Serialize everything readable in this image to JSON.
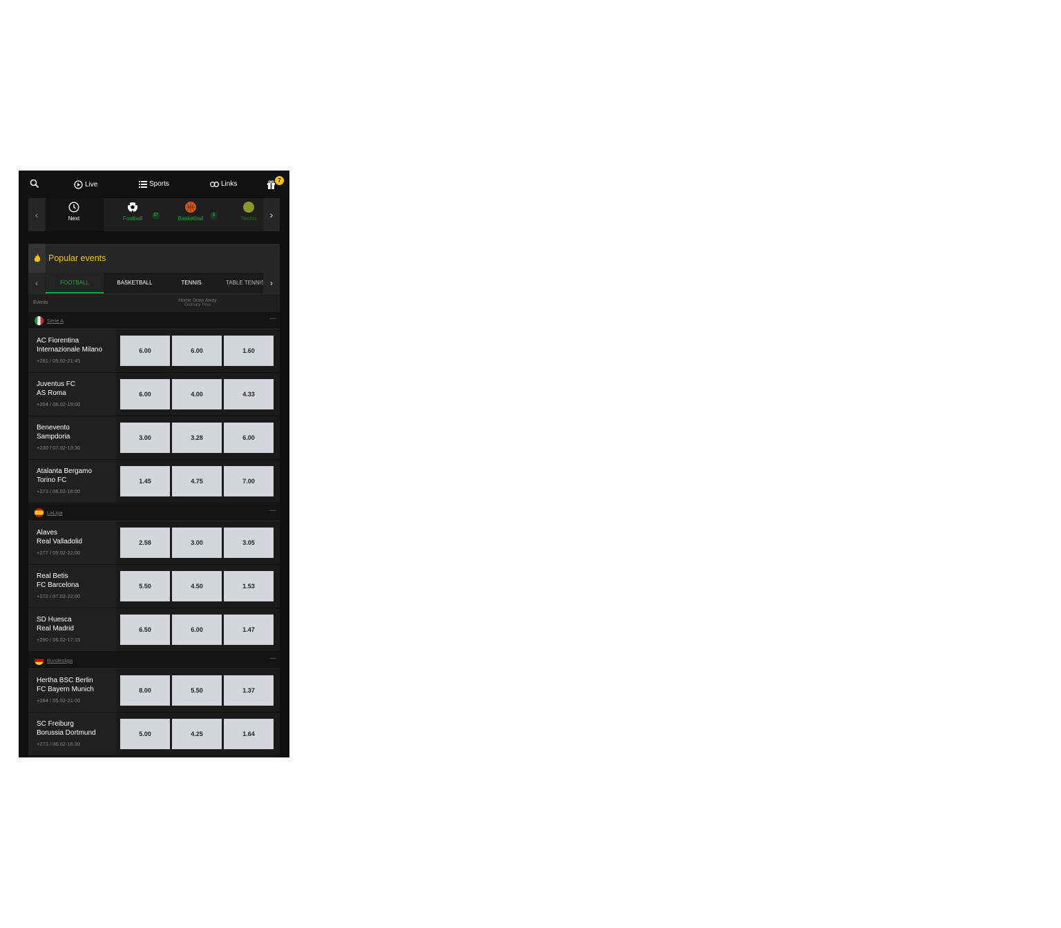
{
  "topnav": {
    "live": "Live",
    "sports": "Sports",
    "links": "Links",
    "gift_badge": "7"
  },
  "sports_bar": {
    "items": [
      {
        "label": "Next",
        "icon": "clock-icon"
      },
      {
        "label": "Football",
        "icon": "football-icon",
        "count": "37"
      },
      {
        "label": "Basketball",
        "icon": "basketball-icon",
        "count": "5"
      },
      {
        "label": "Tennis",
        "icon": "tennis-icon"
      }
    ]
  },
  "popular": {
    "title": "Popular events",
    "tabs": [
      "FOOTBALL",
      "BASKETBALL",
      "TENNIS",
      "TABLE TENNIS"
    ],
    "col_events": "Events",
    "col_hda": "Home Draw Away",
    "col_hda_sub": "Ordinary Time"
  },
  "leagues": [
    {
      "name": "Serie A",
      "events": [
        {
          "home": "AC Fiorentina",
          "away": "Internazionale Milano",
          "meta": "+281 / 05.02-21:45",
          "odds": [
            "6.00",
            "6.00",
            "1.60"
          ]
        },
        {
          "home": "Juventus FC",
          "away": "AS Roma",
          "meta": "+254 / 06.02-19:00",
          "odds": [
            "6.00",
            "4.00",
            "4.33"
          ]
        },
        {
          "home": "Benevento",
          "away": "Sampdoria",
          "meta": "+230 / 07.02-13:30",
          "odds": [
            "3.00",
            "3.28",
            "6.00"
          ]
        },
        {
          "home": "Atalanta Bergamo",
          "away": "Torino FC",
          "meta": "+273 / 06.02-16:00",
          "odds": [
            "1.45",
            "4.75",
            "7.00"
          ]
        }
      ]
    },
    {
      "name": "LaLiga",
      "events": [
        {
          "home": "Alaves",
          "away": "Real Valladolid",
          "meta": "+277 / 05.02-22:00",
          "odds": [
            "2.58",
            "3.00",
            "3.05"
          ]
        },
        {
          "home": "Real Betis",
          "away": "FC Barcelona",
          "meta": "+272 / 07.02-22:00",
          "odds": [
            "5.50",
            "4.50",
            "1.53"
          ]
        },
        {
          "home": "SD Huesca",
          "away": "Real Madrid",
          "meta": "+290 / 06.02-17:15",
          "odds": [
            "6.50",
            "6.00",
            "1.47"
          ]
        }
      ]
    },
    {
      "name": "Bundesliga",
      "events": [
        {
          "home": "Hertha BSC Berlin",
          "away": "FC Bayern Munich",
          "meta": "+284 / 05.02-21:00",
          "odds": [
            "8.00",
            "5.50",
            "1.37"
          ]
        },
        {
          "home": "SC Freiburg",
          "away": "Borussia Dortmund",
          "meta": "+273 / 06.02-16:30",
          "odds": [
            "5.00",
            "4.25",
            "1.64"
          ]
        }
      ]
    }
  ],
  "colors": {
    "accent_green": "#1fa83a",
    "accent_yellow": "#f5c400",
    "background": "#101010"
  }
}
